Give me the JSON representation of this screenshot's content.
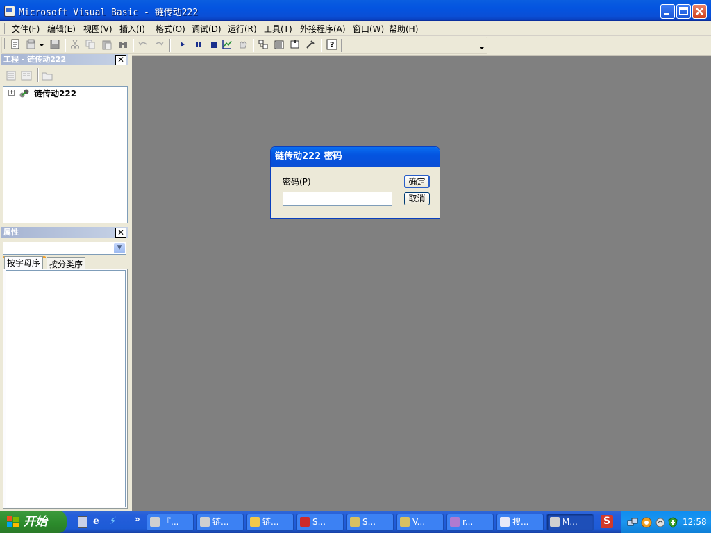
{
  "window": {
    "title": "Microsoft Visual Basic - 链传动222"
  },
  "menubar": {
    "items": [
      "文件(F)",
      "编辑(E)",
      "视图(V)",
      "插入(I)",
      "格式(O)",
      "调试(D)",
      "运行(R)",
      "工具(T)",
      "外接程序(A)",
      "窗口(W)",
      "帮助(H)"
    ]
  },
  "toolbar": {
    "icons": [
      "add-form-icon",
      "add-module-icon",
      "save-icon",
      "cut-icon",
      "copy-icon",
      "paste-icon",
      "find-icon",
      "undo-icon",
      "redo-icon",
      "run-icon",
      "pause-icon",
      "stop-icon",
      "project-explorer-icon",
      "properties-icon",
      "form-layout-icon",
      "object-browser-icon",
      "toolbox-icon",
      "help-icon"
    ]
  },
  "project_panel": {
    "title": "工程 - 链传动222",
    "tree_root": "链传动222"
  },
  "properties_panel": {
    "title": "属性",
    "tabs": [
      "按字母序",
      "按分类序"
    ],
    "selected_object": ""
  },
  "dialog": {
    "title": "链传动222 密码",
    "password_label": "密码(P)",
    "password_value": "",
    "ok_label": "确定",
    "cancel_label": "取消"
  },
  "taskbar": {
    "start_label": "开始",
    "buttons": [
      {
        "label": "『...",
        "icon": "vb-icon",
        "color": "#d0d0d0"
      },
      {
        "label": "链...",
        "icon": "vb-icon",
        "color": "#d0d0d0"
      },
      {
        "label": "链...",
        "icon": "folder-icon",
        "color": "#f1c84b"
      },
      {
        "label": "S...",
        "icon": "solidworks-icon",
        "color": "#cc2a2a"
      },
      {
        "label": "S...",
        "icon": "help-doc-icon",
        "color": "#d8c060"
      },
      {
        "label": "V...",
        "icon": "help-doc-icon",
        "color": "#d8c060"
      },
      {
        "label": "r...",
        "icon": "winrar-icon",
        "color": "#b07ad0"
      },
      {
        "label": "搜...",
        "icon": "document-icon",
        "color": "#e8e8f8"
      },
      {
        "label": "M...",
        "icon": "vb-icon",
        "color": "#d0d0d0"
      }
    ],
    "clock": "12:58"
  }
}
